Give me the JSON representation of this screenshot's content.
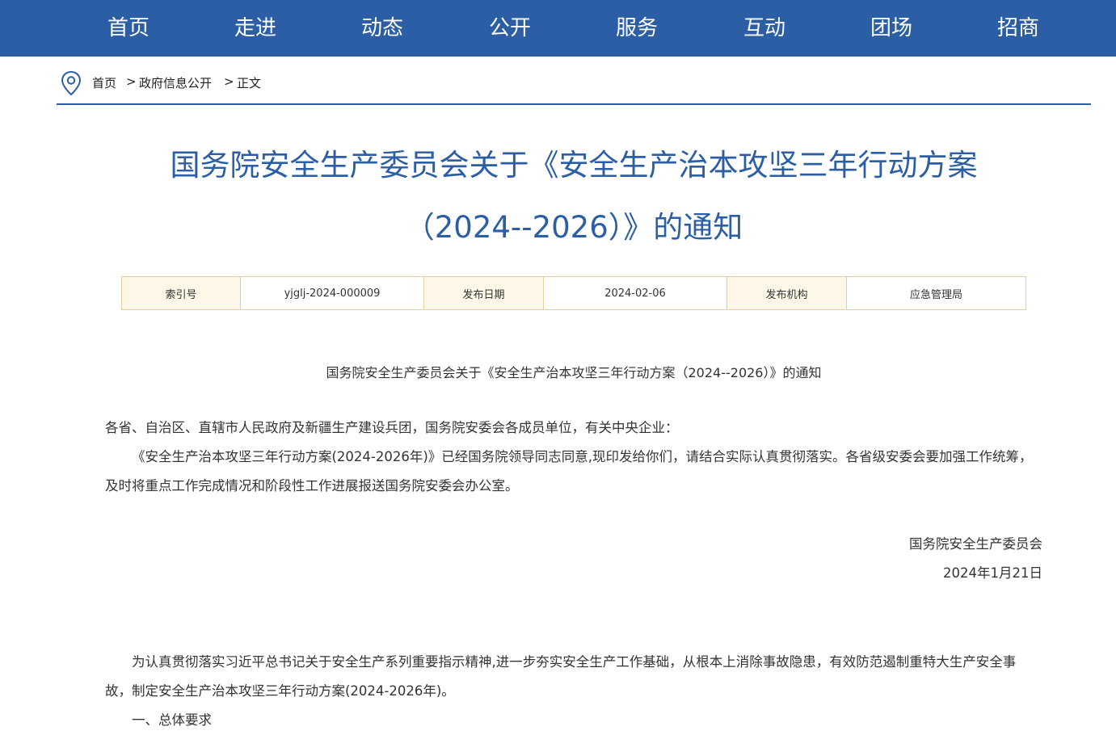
{
  "nav": {
    "items": [
      "首页",
      "走进",
      "动态",
      "公开",
      "服务",
      "互动",
      "团场",
      "招商"
    ]
  },
  "breadcrumb": {
    "home": "首页",
    "sep1": ">",
    "level2": "政府信息公开",
    "sep2": ">",
    "current": "正文"
  },
  "article": {
    "title_line1": "国务院安全生产委员会关于《安全生产治本攻坚三年行动方案",
    "title_line2": "（2024--2026）》的通知",
    "meta": {
      "index_label": "索引号",
      "index_value": "yjglj-2024-000009",
      "date_label": "发布日期",
      "date_value": "2024-02-06",
      "org_label": "发布机构",
      "org_value": "应急管理局"
    },
    "subtitle": "国务院安全生产委员会关于《安全生产治本攻坚三年行动方案（2024--2026）》的通知",
    "salutation": "各省、自治区、直辖市人民政府及新疆生产建设兵团，国务院安委会各成员单位，有关中央企业：",
    "para1": "《安全生产治本攻坚三年行动方案(2024-2026年)》已经国务院领导同志同意,现印发给你们，请结合实际认真贯彻落实。各省级安委会要加强工作统筹，及时将重点工作完成情况和阶段性工作进展报送国务院安委会办公室。",
    "signature": "国务院安全生产委员会",
    "sign_date": "2024年1月21日",
    "para2": "为认真贯彻落实习近平总书记关于安全生产系列重要指示精神,进一步夯实安全生产工作基础，从根本上消除事故隐患，有效防范遏制重特大生产安全事故，制定安全生产治本攻坚三年行动方案(2024-2026年)。",
    "section1": "一、总体要求"
  },
  "colors": {
    "brand": "#2b5ea5",
    "table_border": "#e2cf9e",
    "table_label_bg": "#fdf7e7"
  }
}
